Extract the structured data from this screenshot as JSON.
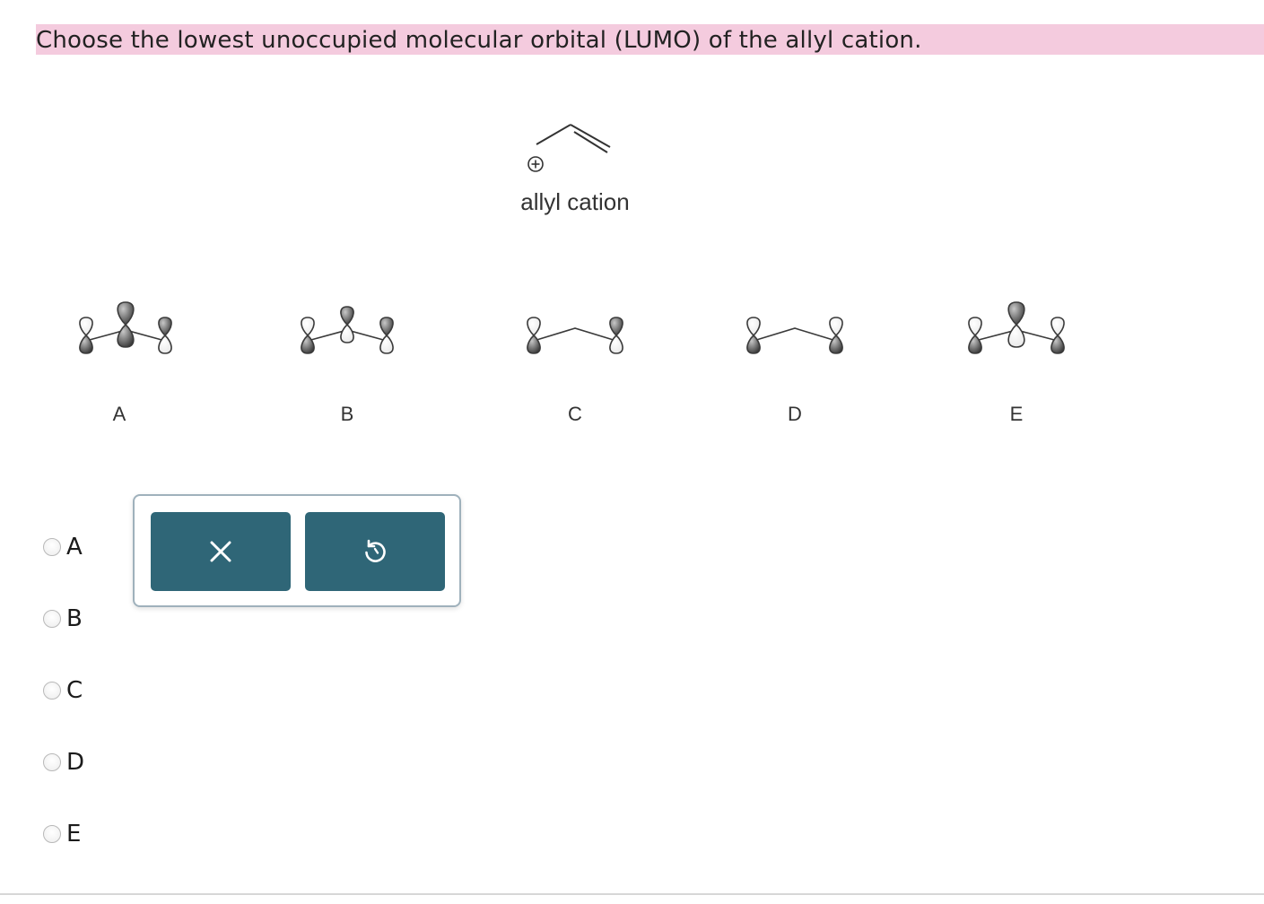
{
  "question": {
    "text": "Choose the lowest unoccupied molecular orbital (LUMO) of the allyl cation.",
    "highlight_color": "#f4cbde"
  },
  "figure": {
    "molecule_label": "allyl cation",
    "charge_symbol": "+",
    "orbital_labels": [
      "A",
      "B",
      "C",
      "D",
      "E"
    ]
  },
  "choices": [
    {
      "label": "A",
      "selected": false
    },
    {
      "label": "B",
      "selected": false
    },
    {
      "label": "C",
      "selected": false
    },
    {
      "label": "D",
      "selected": false
    },
    {
      "label": "E",
      "selected": false
    }
  ],
  "toolbar": {
    "clear_icon": "close-icon",
    "reset_icon": "undo-icon",
    "button_color": "#2f6677"
  }
}
